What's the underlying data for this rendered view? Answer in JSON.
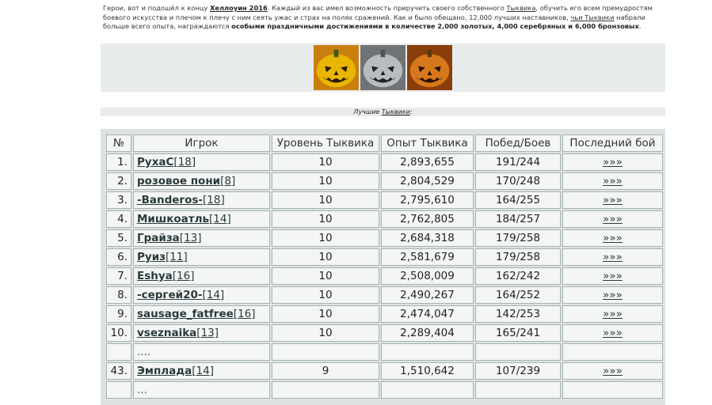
{
  "intro": {
    "p1": "Герои, вот и подошёл к концу ",
    "event": "Хеллоуин 2016",
    "p2": ". Каждый из вас имел возможность приручить своего собственного ",
    "pet1": "Тыквика",
    "p3": ", обучить его всем премудростям боевого искусства и плечом к плечу с ним сеять ужас и страх на полях сражений. Как и было обещано, 12,000 лучших наставников, ",
    "pet2": "чьи Тыквики",
    "p4": " набрали больше всего опыта, награждаются ",
    "reward": "особыми праздничными достижениями в количестве 2,000 золотых, 4,000 серебряных и 6,000 бронзовых",
    "p5": "."
  },
  "pumpkins": [
    {
      "icon": "gold-pumpkin-icon",
      "color": "#d8a700"
    },
    {
      "icon": "silver-pumpkin-icon",
      "color": "#9aa0a4"
    },
    {
      "icon": "bronze-pumpkin-icon",
      "color": "#c9731f"
    }
  ],
  "subhead": {
    "prefix": "Лучшие ",
    "link": "Тыквики",
    "suffix": ":"
  },
  "table": {
    "headers": [
      "№",
      "Игрок",
      "Уровень Тыквика",
      "Опыт Тыквика",
      "Побед/Боев",
      "Последний бой"
    ],
    "rows": [
      {
        "num": "1.",
        "name": "РухаС",
        "lvl": "[18]",
        "level": "10",
        "exp": "2,893,655",
        "wins": "191/244",
        "link": "»»»"
      },
      {
        "num": "2.",
        "name": "розовое пони",
        "lvl": "[8]",
        "level": "10",
        "exp": "2,804,529",
        "wins": "170/248",
        "link": "»»»"
      },
      {
        "num": "3.",
        "name": "-Banderos-",
        "lvl": "[18]",
        "level": "10",
        "exp": "2,795,610",
        "wins": "164/255",
        "link": "»»»"
      },
      {
        "num": "4.",
        "name": "Мишкоатль",
        "lvl": "[14]",
        "level": "10",
        "exp": "2,762,805",
        "wins": "184/257",
        "link": "»»»"
      },
      {
        "num": "5.",
        "name": "Грайза",
        "lvl": "[13]",
        "level": "10",
        "exp": "2,684,318",
        "wins": "179/258",
        "link": "»»»"
      },
      {
        "num": "6.",
        "name": "Руиз",
        "lvl": "[11]",
        "level": "10",
        "exp": "2,581,679",
        "wins": "179/258",
        "link": "»»»"
      },
      {
        "num": "7.",
        "name": "Eshya",
        "lvl": "[16]",
        "level": "10",
        "exp": "2,508,009",
        "wins": "162/242",
        "link": "»»»"
      },
      {
        "num": "8.",
        "name": "-сергей20-",
        "lvl": "[14]",
        "level": "10",
        "exp": "2,490,267",
        "wins": "164/252",
        "link": "»»»"
      },
      {
        "num": "9.",
        "name": "sausage_fatfree",
        "lvl": "[16]",
        "level": "10",
        "exp": "2,474,047",
        "wins": "142/253",
        "link": "»»»"
      },
      {
        "num": "10.",
        "name": "vseznaika",
        "lvl": "[13]",
        "level": "10",
        "exp": "2,289,404",
        "wins": "165/241",
        "link": "»»»"
      }
    ],
    "gap1": "....",
    "row43": {
      "num": "43.",
      "name": "Эмплада",
      "lvl": "[14]",
      "level": "9",
      "exp": "1,510,642",
      "wins": "107/239",
      "link": "»»»"
    },
    "gap2": "..."
  }
}
